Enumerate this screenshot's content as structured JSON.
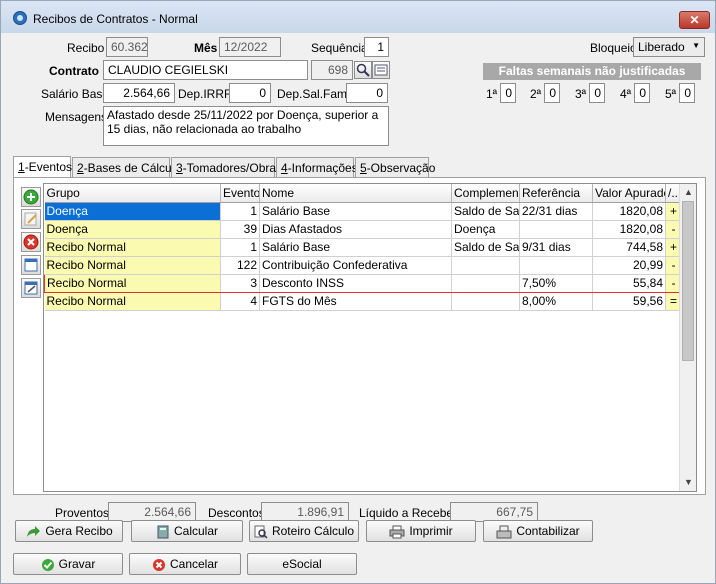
{
  "window": {
    "title": "Recibos de Contratos - Normal",
    "close_label": "✕"
  },
  "header": {
    "recibo_label": "Recibo",
    "recibo_value": "60.362",
    "mes_label": "Mês",
    "mes_value": "12/2022",
    "sequencia_label": "Sequência",
    "sequencia_value": "1",
    "bloqueio_label": "Bloqueio",
    "bloqueio_value": "Liberado",
    "contrato_label": "Contrato",
    "contrato_value": "CLAUDIO CEGIELSKI",
    "contrato_num": "698",
    "salario_label": "Salário Base",
    "salario_value": "2.564,66",
    "dep_irrf_label": "Dep.IRRF",
    "dep_irrf_value": "0",
    "dep_salfam_label": "Dep.Sal.Fam.",
    "dep_salfam_value": "0",
    "mensagens_label": "Mensagens",
    "mensagens_value": "Afastado desde 25/11/2022 por Doença, superior a 15 dias, não relacionada ao trabalho"
  },
  "faltas": {
    "title": "Faltas semanais não justificadas",
    "weeks": [
      {
        "label": "1ª",
        "value": "0"
      },
      {
        "label": "2ª",
        "value": "0"
      },
      {
        "label": "3ª",
        "value": "0"
      },
      {
        "label": "4ª",
        "value": "0"
      },
      {
        "label": "5ª",
        "value": "0"
      }
    ]
  },
  "tabs": [
    {
      "key": "1",
      "label": "-Eventos"
    },
    {
      "key": "2",
      "label": "-Bases de Cálculo"
    },
    {
      "key": "3",
      "label": "-Tomadores/Obras"
    },
    {
      "key": "4",
      "label": "-Informações"
    },
    {
      "key": "5",
      "label": "-Observação"
    }
  ],
  "grid": {
    "columns": [
      "Grupo",
      "Evento",
      "Nome",
      "Complemento",
      "Referência",
      "Valor Apurado",
      "/..."
    ],
    "rows": [
      {
        "grupo": "Doença",
        "evento": "1",
        "nome": "Salário Base",
        "complemento": "Saldo de Salário",
        "referencia": "22/31 dias",
        "valor": "1820,08",
        "sinal": "+"
      },
      {
        "grupo": "Doença",
        "evento": "39",
        "nome": "Dias Afastados",
        "complemento": "Doença",
        "referencia": "",
        "valor": "1820,08",
        "sinal": "-"
      },
      {
        "grupo": "Recibo Normal",
        "evento": "1",
        "nome": "Salário Base",
        "complemento": "Saldo de Salário",
        "referencia": "9/31 dias",
        "valor": "744,58",
        "sinal": "+"
      },
      {
        "grupo": "Recibo Normal",
        "evento": "122",
        "nome": "Contribuição Confederativa",
        "complemento": "",
        "referencia": "",
        "valor": "20,99",
        "sinal": "-"
      },
      {
        "grupo": "Recibo Normal",
        "evento": "3",
        "nome": "Desconto INSS",
        "complemento": "",
        "referencia": "7,50%",
        "valor": "55,84",
        "sinal": "-"
      },
      {
        "grupo": "Recibo Normal",
        "evento": "4",
        "nome": "FGTS do Mês",
        "complemento": "",
        "referencia": "8,00%",
        "valor": "59,56",
        "sinal": "="
      }
    ]
  },
  "totals": {
    "proventos_label": "Proventos",
    "proventos_value": "2.564,66",
    "descontos_label": "Descontos",
    "descontos_value": "1.896,91",
    "liquido_label": "Líquido a Receber",
    "liquido_value": "667,75"
  },
  "actions": {
    "gera_recibo": "Gera Recibo",
    "calcular": "Calcular",
    "roteiro": "Roteiro Cálculo",
    "imprimir": "Imprimir",
    "contabilizar": "Contabilizar",
    "gravar": "Gravar",
    "cancelar": "Cancelar",
    "esocial": "eSocial"
  }
}
